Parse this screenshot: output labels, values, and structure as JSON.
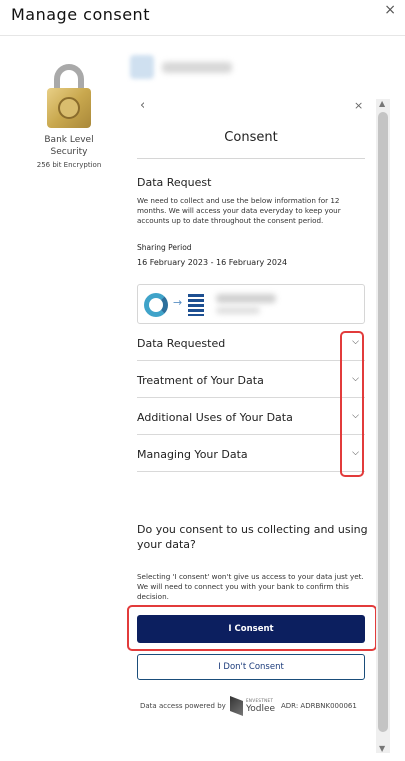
{
  "header": {
    "title": "Manage consent",
    "close_icon": "×"
  },
  "security": {
    "icon": "padlock-icon",
    "title": "Bank Level Security",
    "subtitle": "256 bit Encryption"
  },
  "panel": {
    "back_icon": "‹",
    "close_icon": "×",
    "title": "Consent",
    "data_request": {
      "title": "Data Request",
      "description": "We need to collect and use the below information for 12 months. We will access your data everyday to keep your accounts up to date throughout the consent period.",
      "sharing_period_label": "Sharing Period",
      "sharing_period_value": "16 February 2023 - 16 February 2024"
    },
    "connection": {
      "arrow": "→"
    },
    "accordion": [
      {
        "label": "Data Requested",
        "chevron": "⌄"
      },
      {
        "label": "Treatment of Your Data",
        "chevron": "⌄"
      },
      {
        "label": "Additional Uses of Your Data",
        "chevron": "⌄"
      },
      {
        "label": "Managing Your Data",
        "chevron": "⌄"
      }
    ],
    "question": "Do you consent to us collecting and using your data?",
    "note": "Selecting 'I consent' won't give us access to your data just yet. We will need to connect you with your bank to confirm this decision.",
    "consent_button": "I Consent",
    "decline_button": "I Don't Consent",
    "footer": {
      "powered_by": "Data access powered by",
      "yodlee_tag": "ENVESTNET",
      "yodlee_name": "Yodlee",
      "adr": "ADR: ADRBNK000061"
    }
  },
  "scrollbar": {
    "up": "▲",
    "down": "▼"
  },
  "colors": {
    "primary_button": "#0c1f5f",
    "highlight": "#e23b3b"
  }
}
